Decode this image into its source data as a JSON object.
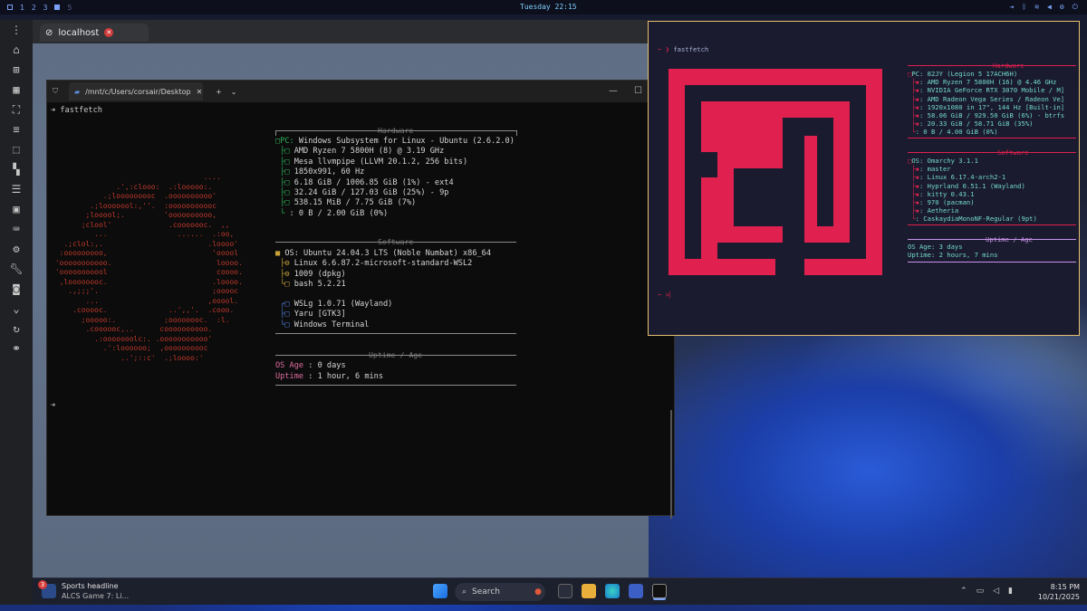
{
  "topbar": {
    "workspaces": [
      "1",
      "2",
      "3",
      "5"
    ],
    "clock": "Tuesday 22:15",
    "tray_icons": [
      "exit-icon",
      "bluetooth-icon",
      "wifi-icon",
      "volume-icon",
      "settings-icon",
      "power-icon"
    ]
  },
  "browser": {
    "tab_title": "localhost",
    "rail_icons": [
      "menu-icon",
      "home-icon",
      "add-icon",
      "grid-icon",
      "fullscreen-icon",
      "list-icon",
      "select-icon",
      "tile-icon",
      "list2-icon",
      "window-icon",
      "keyboard-icon",
      "gear-icon",
      "wrench-icon",
      "camera-icon",
      "chevron-down-icon",
      "refresh-icon",
      "link-icon"
    ]
  },
  "wt": {
    "tab_title": "/mnt/c/Users/corsair/Desktop",
    "prompt1": "fastfetch",
    "hardware_header": "Hardware",
    "hardware": [
      {
        "key": "PC",
        "val": "Windows Subsystem for Linux - Ubuntu (2.6.2.0)"
      },
      {
        "key": "",
        "val": "AMD Ryzen 7 5800H (8) @ 3.19 GHz"
      },
      {
        "key": "",
        "val": "Mesa llvmpipe (LLVM 20.1.2, 256 bits)"
      },
      {
        "key": "",
        "val": "1850x991, 60 Hz"
      },
      {
        "key": "",
        "val": "6.18 GiB / 1006.85 GiB (1%) - ext4"
      },
      {
        "key": "",
        "val": "32.24 GiB / 127.03 GiB (25%) - 9p"
      },
      {
        "key": "",
        "val": "538.15 MiB / 7.75 GiB (7%)"
      },
      {
        "key": "",
        "val": ": 0 B / 2.00 GiB (0%)"
      }
    ],
    "software_header": "Software",
    "software": [
      "OS: Ubuntu 24.04.3 LTS (Noble Numbat) x86_64",
      "Linux 6.6.87.2-microsoft-standard-WSL2",
      "1009 (dpkg)",
      "bash 5.2.21"
    ],
    "software2": [
      "WSLg 1.0.71 (Wayland)",
      "Yaru [GTK3]",
      "Windows Terminal"
    ],
    "uptime_header": "Uptime / Age",
    "os_age_label": "OS Age",
    "os_age": ": 0 days",
    "uptime_label": "Uptime",
    "uptime": ": 1 hour, 6 mins",
    "logo_lines": [
      "                                   ....",
      "               .',:clooo:  .:looooo:.",
      "            .;looooooooc  .oooooooooo'",
      "         .;looooool:,''.  :ooooooooooc",
      "        ;looool;.         'oooooooooo,",
      "       ;clool'             .cooooooc.  ,,",
      "          ...                ......  .:oo,",
      "   .;clol:,.                        .loooo'",
      "  :ooooooooo,                        'ooool",
      " 'ooooooooooo.                        loooo.",
      " 'ooooooooool                         coooo.",
      "  ,loooooooc.                        .loooo.",
      "    .,;;;'.                          ;ooooc",
      "        ...                         ,ooool.",
      "     .cooooc.              ..',,'.  .cooo.",
      "       ;ooooo:.           ;oooooooc.  :l.",
      "        .coooooc,..      coooooooooo.",
      "          .:ooooooolc:. .ooooooooooo'",
      "            .':loooooo;  ,oooooooooc",
      "                ..';::c'  .;loooo:'"
    ]
  },
  "kitty": {
    "prompt": "fastfetch",
    "hardware_header": "Hardware",
    "hardware": [
      "PC: 82JY (Legion 5 17ACH6H)",
      ": AMD Ryzen 7 5800H (16) @ 4.46 GHz",
      ": NVIDIA GeForce RTX 3070 Mobile / M]",
      ": AMD Radeon Vega Series / Radeon Ve]",
      ": 1920x1080 in 17\", 144 Hz [Built-in]",
      ": 58.06 GiB / 929.50 GiB (6%) - btrfs",
      ": 20.33 GiB / 58.71 GiB (35%)",
      ": 0 B / 4.00 GiB (0%)"
    ],
    "software_header": "Software",
    "software": [
      "OS: Omarchy 3.1.1",
      ": master",
      ": Linux 6.17.4-arch2-1",
      ": Hyprland 0.51.1 (Wayland)",
      ": kitty 0.43.1",
      ": 970 (pacman)",
      ": Aetheria",
      ": CaskaydiaMonoNF-Regular (9pt)"
    ],
    "uptime_header": "Uptime / Age",
    "os_age": "OS Age: 3 days",
    "uptime": "Uptime: 2 hours, 7 mins",
    "prompt2": "~ >"
  },
  "taskbar": {
    "news_title": "Sports headline",
    "news_sub": "ALCS Game 7: Li...",
    "news_badge": "3",
    "search_placeholder": "Search",
    "time": "8:15 PM",
    "date": "10/21/2025"
  },
  "colors": {
    "accent_red": "#e0204e",
    "kitty_border": "#e8c070",
    "wt_green": "#2fb25b"
  }
}
